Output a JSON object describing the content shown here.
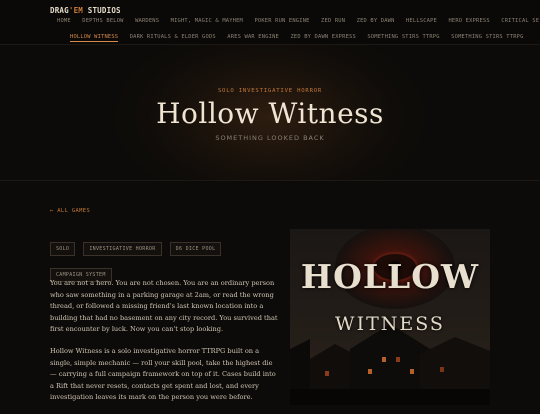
{
  "brand": {
    "prefix": "DRAG",
    "amp": "'EM",
    "suffix": " STUDIOS"
  },
  "nav": {
    "row1": [
      "HOME",
      "DEPTHS BELOW",
      "WARDENS",
      "MIGHT, MAGIC & MAYHEM",
      "POKER RUN ENGINE",
      "ZED RUN",
      "ZED BY DAWN",
      "HELLSCAPE",
      "HERO EXPRESS",
      "CRITICAL SE"
    ],
    "row2": [
      "HOLLOW WITNESS",
      "DARK RITUALS & ELDER GODS",
      "ARES WAR ENGINE",
      "ZED BY DAWN EXPRESS",
      "SOMETHING STIRS TTRPG",
      "SOMETHING STIRS TTRPG"
    ],
    "active_index": 0
  },
  "hero": {
    "eyebrow": "SOLO INVESTIGATIVE HORROR",
    "title": "Hollow Witness",
    "subtitle": "SOMETHING LOOKED BACK"
  },
  "back_link": "← ALL GAMES",
  "tags": [
    "SOLO",
    "INVESTIGATIVE HORROR",
    "D6 DICE POOL",
    "CAMPAIGN SYSTEM"
  ],
  "body": {
    "p1": "You are not a hero. You are not chosen. You are an ordinary person who saw something in a parking garage at 2am, or read the wrong thread, or followed a missing friend's last known location into a building that had no basement on any city record. You survived that first encounter by luck. Now you can't stop looking.",
    "p2": "Hollow Witness is a solo investigative horror TTRPG built on a single, simple mechanic — roll your skill pool, take the highest die — carrying a full campaign framework on top of it. Cases build into a Rift that never resets, contacts get spent and lost, and every investigation leaves its mark on the person you were before."
  },
  "cover": {
    "title_line1": "HOLLOW",
    "title_line2": "WITNESS"
  },
  "colors": {
    "accent": "#c47838",
    "background": "#0d0b09",
    "text": "#cfc4b4"
  }
}
